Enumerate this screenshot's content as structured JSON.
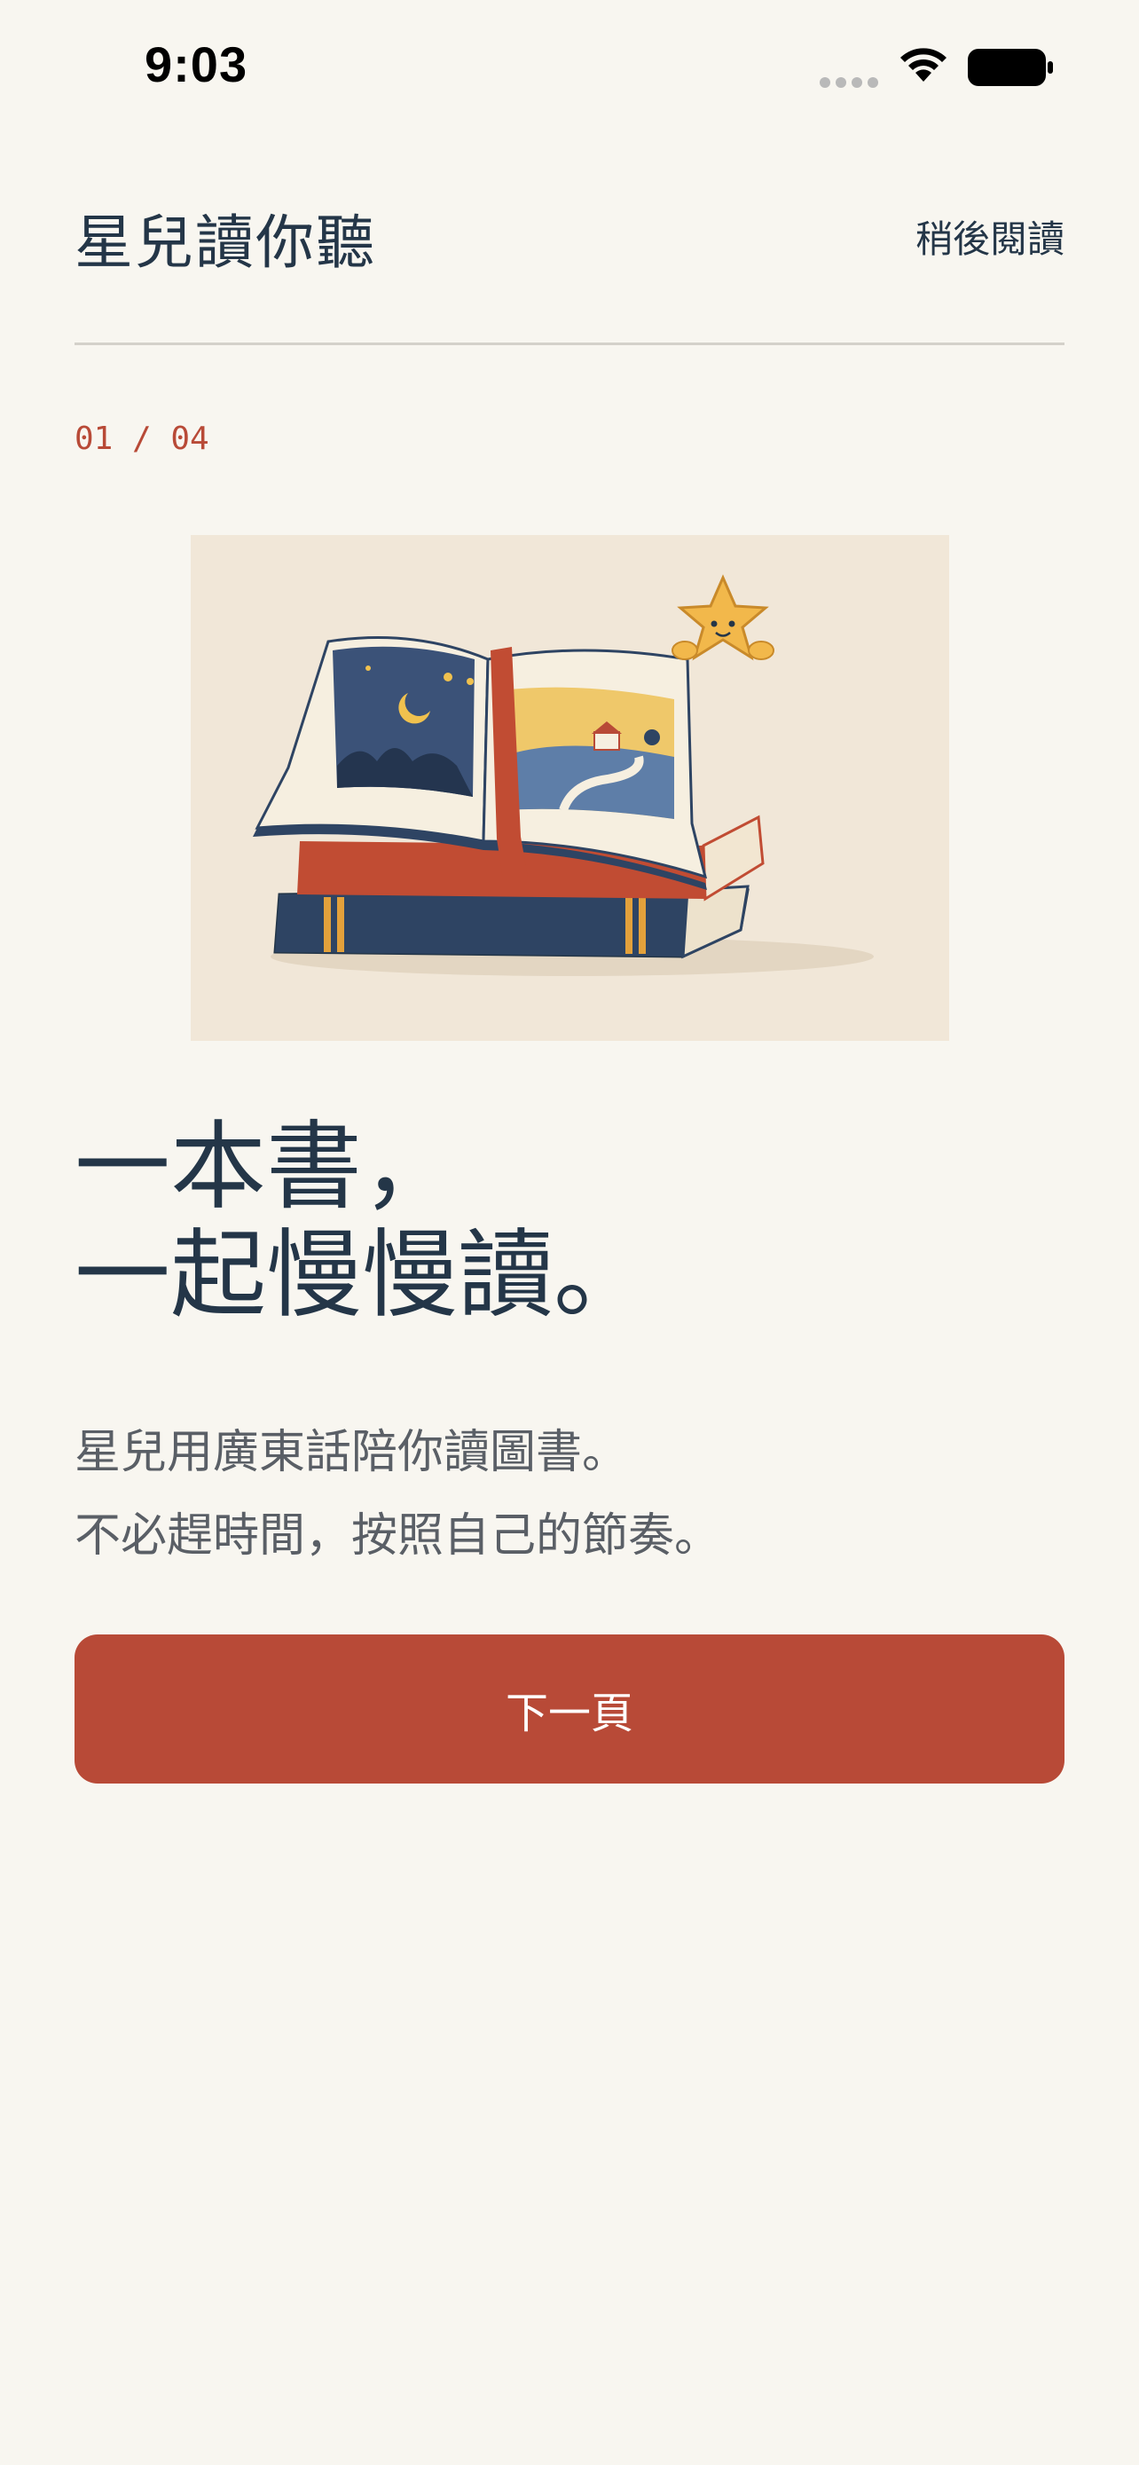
{
  "status_bar": {
    "time": "9:03"
  },
  "header": {
    "app_title": "星兒讀你聽",
    "later_label": "稍後閱讀"
  },
  "onboarding": {
    "page_counter": "01 / 04",
    "illustration_icon": "stacked-picture-books-with-star-illustration",
    "headline_line1": "一本書，",
    "headline_line2": "一起慢慢讀。",
    "body_line1": "星兒用廣東話陪你讀圖書。",
    "body_line2": "不必趕時間，按照自己的節奏。",
    "next_label": "下一頁"
  },
  "colors": {
    "background": "#F8F6F0",
    "primary_text": "#243648",
    "accent": "#B84A37",
    "secondary_text": "#5A5F66"
  }
}
